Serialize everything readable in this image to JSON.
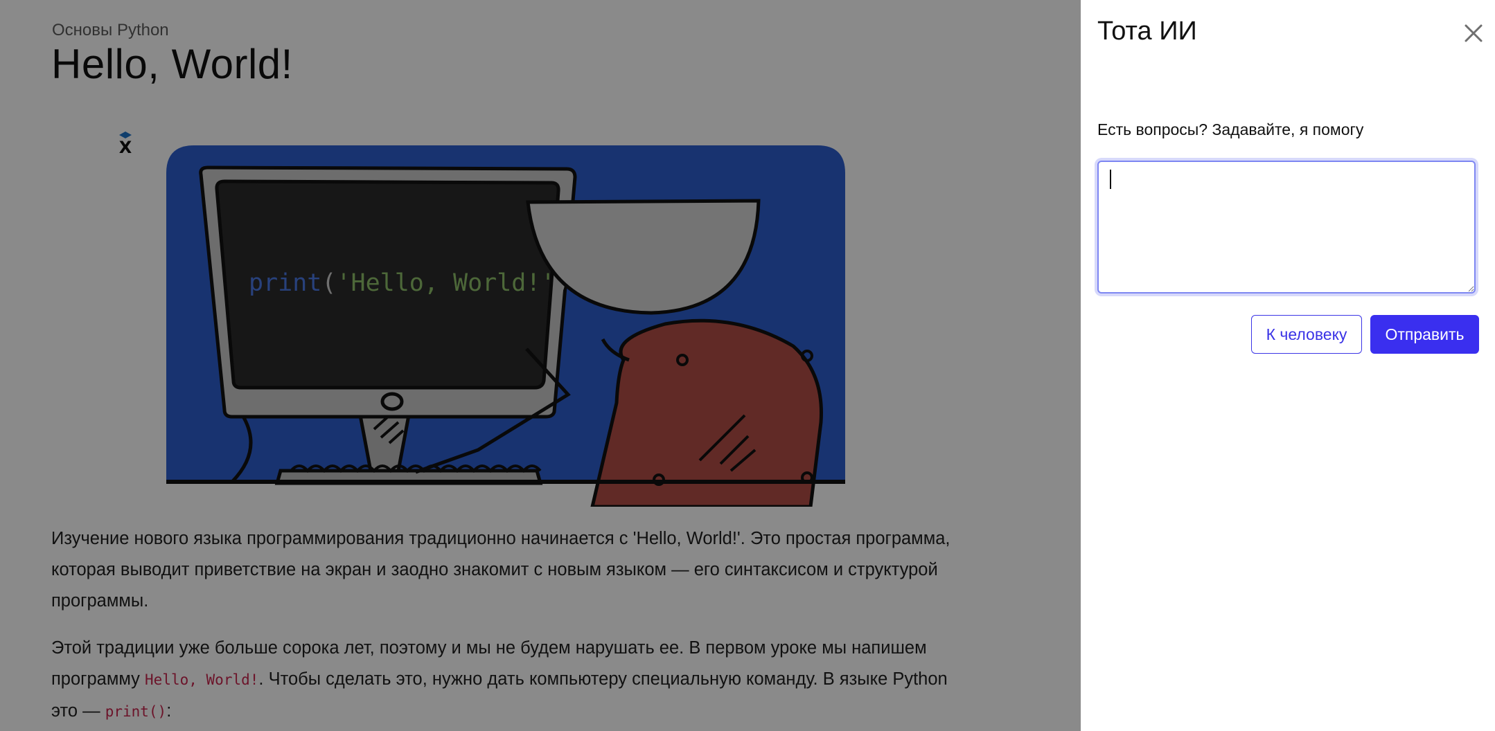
{
  "lesson": {
    "breadcrumb": "Основы Python",
    "title": "Hello, World!",
    "logo_letter": "X",
    "illustration": {
      "code_fn": "print",
      "code_open": "(",
      "code_string": "'Hello, World!'",
      "code_close": ")"
    },
    "paragraph1": "Изучение нового языка программирования традиционно начинается с 'Hello, World!'. Это простая программа, которая выводит приветствие на экран и заодно знакомит с новым языком — его синтаксисом и структурой программы.",
    "paragraph2": {
      "text_before": "Этой традиции уже больше сорока лет, поэтому и мы не будем нарушать ее. В первом уроке мы напишем программу ",
      "code1": "Hello, World!",
      "text_middle": ". Чтобы сделать это, нужно дать компьютеру специальную команду. В языке Python это — ",
      "code2": "print()",
      "text_after": ":"
    }
  },
  "drawer": {
    "title": "Тота ИИ",
    "prompt": "Есть вопросы? Задавайте, я помогу",
    "input_value": "",
    "human_button": "К человеку",
    "send_button": "Отправить",
    "icons": {
      "close": "close-icon",
      "logo": "hexlet-logo-icon"
    },
    "colors": {
      "accent": "#3a2fef",
      "focus_ring": "#7d86f2"
    }
  }
}
